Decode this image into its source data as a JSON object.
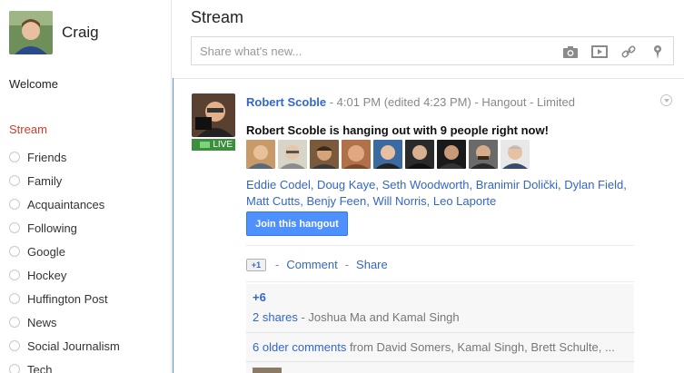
{
  "user": {
    "name": "Craig"
  },
  "sidebar": {
    "welcome": "Welcome",
    "stream_label": "Stream",
    "circles": [
      {
        "label": "Friends"
      },
      {
        "label": "Family"
      },
      {
        "label": "Acquaintances"
      },
      {
        "label": "Following"
      },
      {
        "label": "Google"
      },
      {
        "label": "Hockey"
      },
      {
        "label": "Huffington Post"
      },
      {
        "label": "News"
      },
      {
        "label": "Social Journalism"
      },
      {
        "label": "Tech"
      }
    ]
  },
  "main": {
    "title": "Stream",
    "share_placeholder": "Share what's new...",
    "share_icons": [
      "camera-icon",
      "video-icon",
      "link-icon",
      "location-pin-icon"
    ]
  },
  "post": {
    "author": "Robert Scoble",
    "meta": " - 4:01 PM (edited 4:23 PM) - Hangout - Limited",
    "live_label": "LIVE",
    "body": "Robert Scoble is hanging out with 9 people right now!",
    "participant_names_line1": "Eddie Codel, Doug Kaye, Seth Woodworth, Branimir Dolički, Dylan Field,",
    "participant_names_line2": "Matt Cutts, Benjy Feen, Will Norris, Leo Laporte",
    "join_label": "Join this hangout",
    "plusone_label": "+1",
    "comment_label": "Comment",
    "share_label": "Share",
    "action_separator": "-",
    "plus_count": "+6",
    "shares_count": "2 shares",
    "shares_people": " - Joshua Ma and Kamal Singh",
    "older_comments": "6 older comments",
    "older_from": " from David Somers, Kamal Singh, Brett Schulte, ..."
  },
  "colors": {
    "accent_link": "#3366cc",
    "stream_active": "#c8402f",
    "join_button": "#4d90fe",
    "live_badge": "#3d8f3d",
    "rail": "#5b8fd8"
  }
}
